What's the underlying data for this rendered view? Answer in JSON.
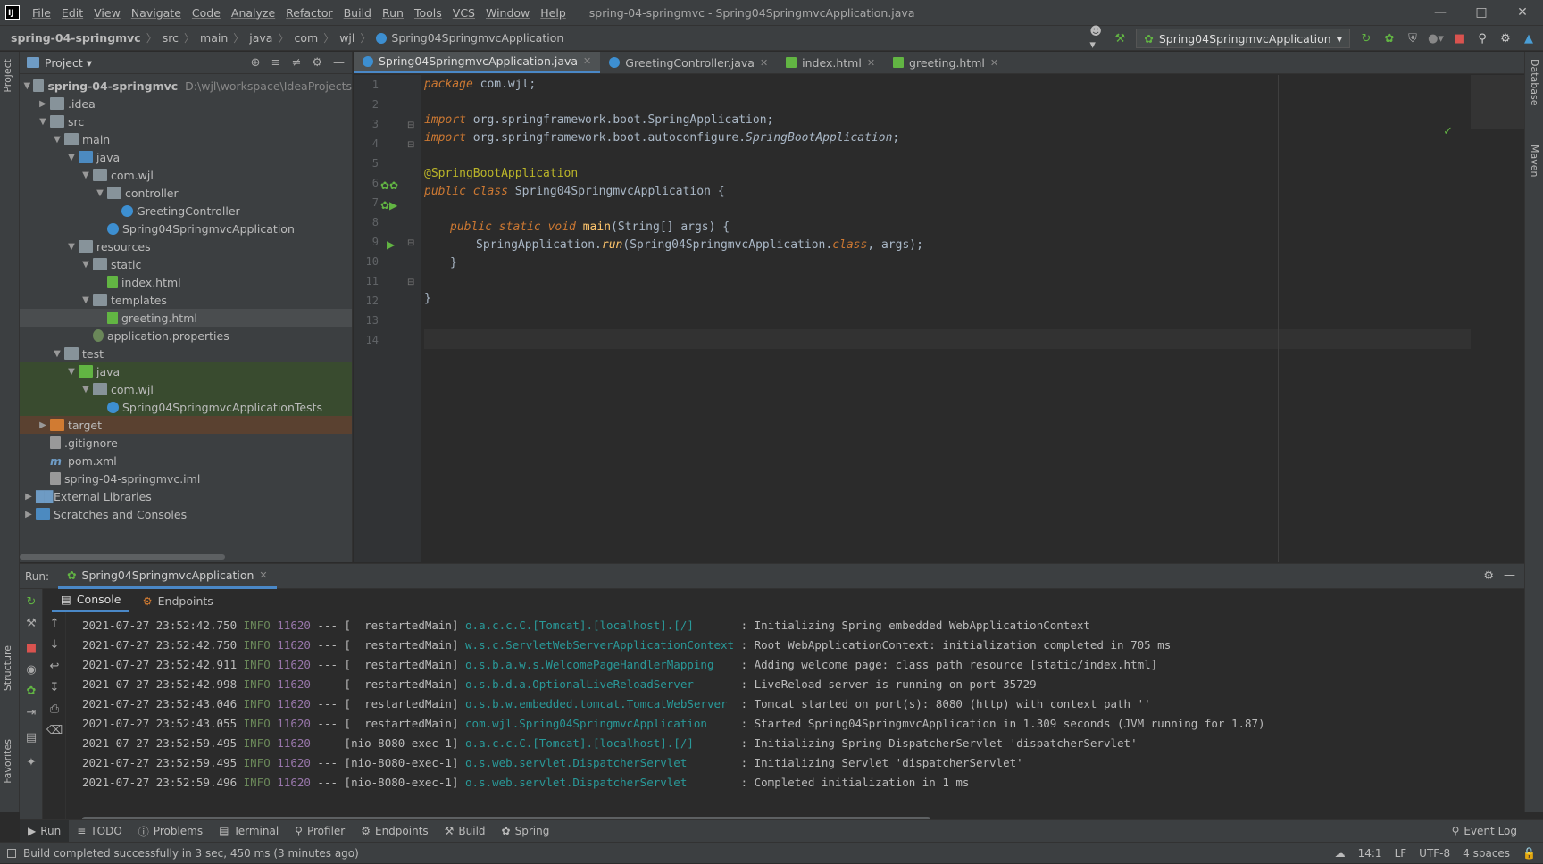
{
  "menubar": {
    "items": [
      "File",
      "Edit",
      "View",
      "Navigate",
      "Code",
      "Analyze",
      "Refactor",
      "Build",
      "Run",
      "Tools",
      "VCS",
      "Window",
      "Help"
    ],
    "window_title": "spring-04-springmvc - Spring04SpringmvcApplication.java"
  },
  "breadcrumbs": [
    "spring-04-springmvc",
    "src",
    "main",
    "java",
    "com",
    "wjl",
    "Spring04SpringmvcApplication"
  ],
  "toolbar": {
    "run_config": "Spring04SpringmvcApplication"
  },
  "project_panel": {
    "title": "Project",
    "tree": [
      {
        "label": "spring-04-springmvc",
        "hint": "D:\\wjl\\workspace\\IdeaProjects"
      },
      {
        "label": ".idea"
      },
      {
        "label": "src"
      },
      {
        "label": "main"
      },
      {
        "label": "java"
      },
      {
        "label": "com.wjl"
      },
      {
        "label": "controller"
      },
      {
        "label": "GreetingController"
      },
      {
        "label": "Spring04SpringmvcApplication"
      },
      {
        "label": "resources"
      },
      {
        "label": "static"
      },
      {
        "label": "index.html"
      },
      {
        "label": "templates"
      },
      {
        "label": "greeting.html"
      },
      {
        "label": "application.properties"
      },
      {
        "label": "test"
      },
      {
        "label": "java"
      },
      {
        "label": "com.wjl"
      },
      {
        "label": "Spring04SpringmvcApplicationTests"
      },
      {
        "label": "target"
      },
      {
        "label": ".gitignore"
      },
      {
        "label": "pom.xml"
      },
      {
        "label": "spring-04-springmvc.iml"
      },
      {
        "label": "External Libraries"
      },
      {
        "label": "Scratches and Consoles"
      }
    ]
  },
  "editor": {
    "tabs": [
      "Spring04SpringmvcApplication.java",
      "GreetingController.java",
      "index.html",
      "greeting.html"
    ],
    "line_numbers": [
      "1",
      "2",
      "3",
      "4",
      "5",
      "6",
      "7",
      "8",
      "9",
      "10",
      "11",
      "12",
      "13",
      "14"
    ],
    "code": {
      "l1_kw": "package",
      "l1_rest": " com.wjl;",
      "l3_kw": "import",
      "l3_rest": " org.springframework.boot.SpringApplication;",
      "l4_kw": "import",
      "l4_rest": " org.springframework.boot.autoconfigure.",
      "l4_cls": "SpringBootApplication",
      "l4_end": ";",
      "l6_ann": "@SpringBootApplication",
      "l7_kw": "public class",
      "l7_rest": " Spring04SpringmvcApplication {",
      "l9_kw": "public static void",
      "l9_fn": " main",
      "l9_rest": "(String[] ",
      "l9_pm": "args",
      "l9_end": ") {",
      "l10_a": "SpringApplication.",
      "l10_fn": "run",
      "l10_b": "(Spring04SpringmvcApplication.",
      "l10_kw": "class",
      "l10_c": ", ",
      "l10_pm": "args",
      "l10_d": ");",
      "l11": "}",
      "l13": "}"
    }
  },
  "side_tabs": {
    "left_top": "Project",
    "left_structure": "Structure",
    "left_favorites": "Favorites",
    "right_database": "Database",
    "right_maven": "Maven"
  },
  "run_panel": {
    "label": "Run:",
    "tab": "Spring04SpringmvcApplication",
    "subtabs": [
      "Console",
      "Endpoints"
    ],
    "logs": [
      {
        "ts": "2021-07-27 23:52:42.750",
        "level": "INFO",
        "pid": "11620",
        "thread": "[  restartedMain]",
        "logger": "o.a.c.c.C.[Tomcat].[localhost].[/]      ",
        "msg": ": Initializing Spring embedded WebApplicationContext"
      },
      {
        "ts": "2021-07-27 23:52:42.750",
        "level": "INFO",
        "pid": "11620",
        "thread": "[  restartedMain]",
        "logger": "w.s.c.ServletWebServerApplicationContext",
        "msg": ": Root WebApplicationContext: initialization completed in 705 ms"
      },
      {
        "ts": "2021-07-27 23:52:42.911",
        "level": "INFO",
        "pid": "11620",
        "thread": "[  restartedMain]",
        "logger": "o.s.b.a.w.s.WelcomePageHandlerMapping   ",
        "msg": ": Adding welcome page: class path resource [static/index.html]"
      },
      {
        "ts": "2021-07-27 23:52:42.998",
        "level": "INFO",
        "pid": "11620",
        "thread": "[  restartedMain]",
        "logger": "o.s.b.d.a.OptionalLiveReloadServer      ",
        "msg": ": LiveReload server is running on port 35729"
      },
      {
        "ts": "2021-07-27 23:52:43.046",
        "level": "INFO",
        "pid": "11620",
        "thread": "[  restartedMain]",
        "logger": "o.s.b.w.embedded.tomcat.TomcatWebServer ",
        "msg": ": Tomcat started on port(s): 8080 (http) with context path ''"
      },
      {
        "ts": "2021-07-27 23:52:43.055",
        "level": "INFO",
        "pid": "11620",
        "thread": "[  restartedMain]",
        "logger": "com.wjl.Spring04SpringmvcApplication    ",
        "msg": ": Started Spring04SpringmvcApplication in 1.309 seconds (JVM running for 1.87)"
      },
      {
        "ts": "2021-07-27 23:52:59.495",
        "level": "INFO",
        "pid": "11620",
        "thread": "[nio-8080-exec-1]",
        "logger": "o.a.c.c.C.[Tomcat].[localhost].[/]      ",
        "msg": ": Initializing Spring DispatcherServlet 'dispatcherServlet'"
      },
      {
        "ts": "2021-07-27 23:52:59.495",
        "level": "INFO",
        "pid": "11620",
        "thread": "[nio-8080-exec-1]",
        "logger": "o.s.web.servlet.DispatcherServlet       ",
        "msg": ": Initializing Servlet 'dispatcherServlet'"
      },
      {
        "ts": "2021-07-27 23:52:59.496",
        "level": "INFO",
        "pid": "11620",
        "thread": "[nio-8080-exec-1]",
        "logger": "o.s.web.servlet.DispatcherServlet       ",
        "msg": ": Completed initialization in 1 ms"
      }
    ]
  },
  "bottom_tabs": [
    "Run",
    "TODO",
    "Problems",
    "Terminal",
    "Profiler",
    "Endpoints",
    "Build",
    "Spring"
  ],
  "event_log": "Event Log",
  "status": {
    "message": "Build completed successfully in 3 sec, 450 ms (3 minutes ago)",
    "position": "14:1",
    "line_sep": "LF",
    "encoding": "UTF-8",
    "indent": "4 spaces"
  },
  "colors": {
    "accent": "#4a88c7",
    "background": "#2b2b2b",
    "panel": "#3c3f41"
  }
}
